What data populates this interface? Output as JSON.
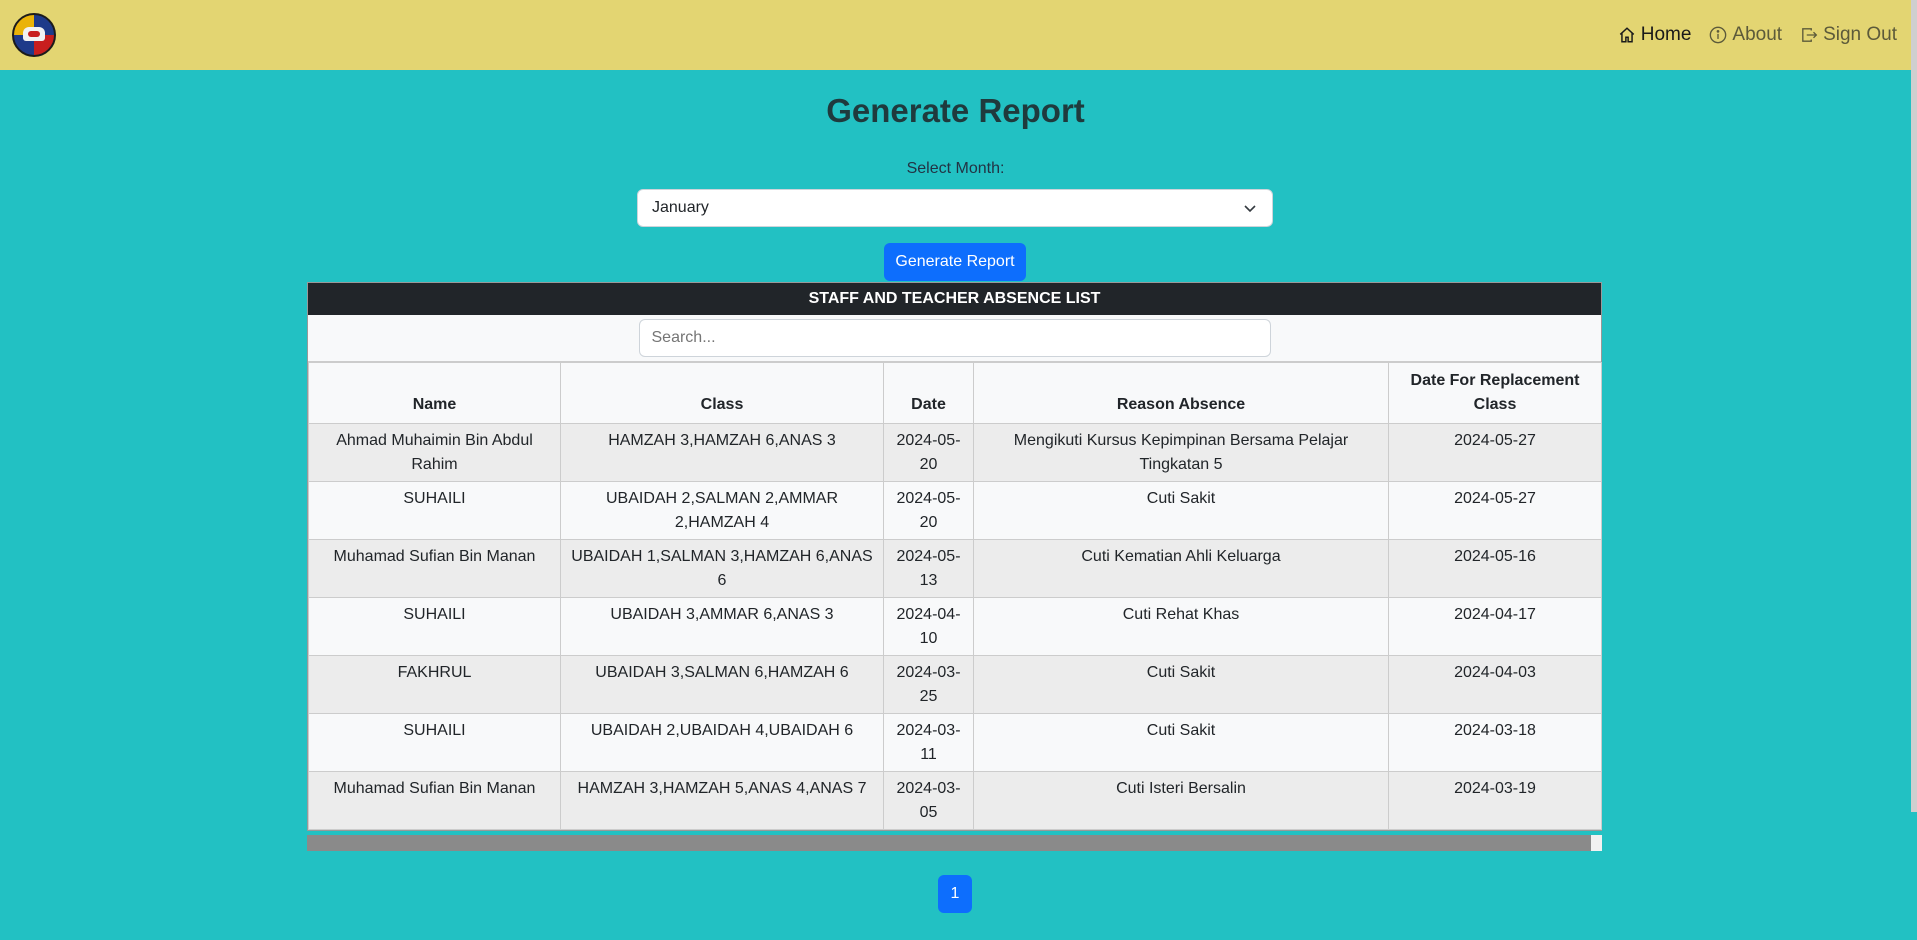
{
  "nav": {
    "home": "Home",
    "about": "About",
    "signout": "Sign Out"
  },
  "page": {
    "title": "Generate Report",
    "select_label": "Select Month:",
    "selected_month": "January",
    "generate_button": "Generate Report"
  },
  "table": {
    "caption": "STAFF AND TEACHER ABSENCE LIST",
    "search_placeholder": "Search...",
    "headers": [
      "Name",
      "Class",
      "Date",
      "Reason Absence",
      "Date For Replacement Class"
    ],
    "rows": [
      [
        "Ahmad Muhaimin Bin Abdul Rahim",
        "HAMZAH 3,HAMZAH 6,ANAS 3",
        "2024-05-20",
        "Mengikuti Kursus Kepimpinan Bersama Pelajar Tingkatan 5",
        "2024-05-27"
      ],
      [
        "SUHAILI",
        "UBAIDAH 2,SALMAN 2,AMMAR 2,HAMZAH 4",
        "2024-05-20",
        "Cuti Sakit",
        "2024-05-27"
      ],
      [
        "Muhamad Sufian Bin Manan",
        "UBAIDAH 1,SALMAN 3,HAMZAH 6,ANAS 6",
        "2024-05-13",
        "Cuti Kematian Ahli Keluarga",
        "2024-05-16"
      ],
      [
        "SUHAILI",
        "UBAIDAH 3,AMMAR 6,ANAS 3",
        "2024-04-10",
        "Cuti Rehat Khas",
        "2024-04-17"
      ],
      [
        "FAKHRUL",
        "UBAIDAH 3,SALMAN 6,HAMZAH 6",
        "2024-03-25",
        "Cuti Sakit",
        "2024-04-03"
      ],
      [
        "SUHAILI",
        "UBAIDAH 2,UBAIDAH 4,UBAIDAH 6",
        "2024-03-11",
        "Cuti Sakit",
        "2024-03-18"
      ],
      [
        "Muhamad Sufian Bin Manan",
        "HAMZAH 3,HAMZAH 5,ANAS 4,ANAS 7",
        "2024-03-05",
        "Cuti Isteri Bersalin",
        "2024-03-19"
      ]
    ]
  },
  "pagination": {
    "current": "1"
  },
  "colors": {
    "background": "#22c1c3",
    "navbar": "#e3d572",
    "primary": "#0d6efd",
    "table_caption": "#212529"
  },
  "icons": {
    "home": "house-icon",
    "about": "info-circle-icon",
    "signout": "box-arrow-right-icon",
    "select": "chevron-down-icon"
  }
}
